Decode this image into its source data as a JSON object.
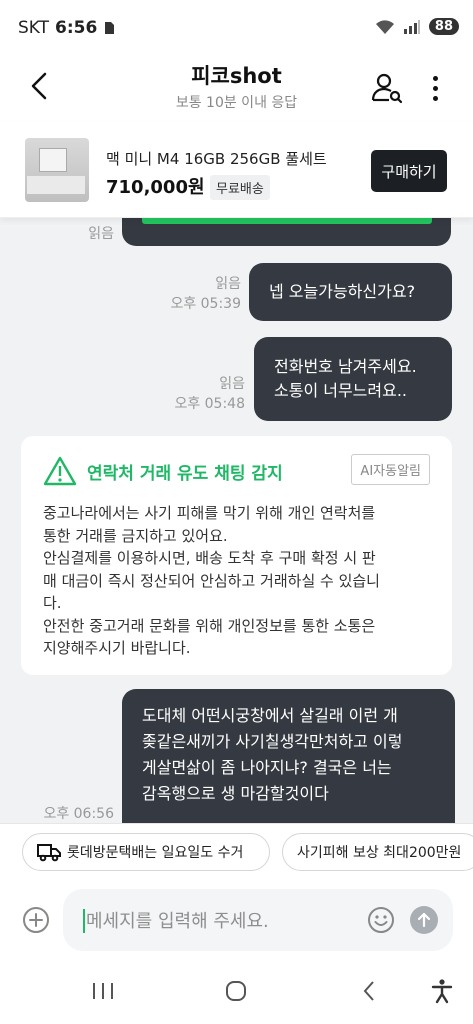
{
  "status_bar": {
    "carrier": "SKT",
    "time": "6:56",
    "battery": "88"
  },
  "header": {
    "title": "피코shot",
    "subtitle": "보통 10분 이내 응답"
  },
  "product": {
    "name": "맥 미니 M4 16GB 256GB 풀세트",
    "price": "710,000원",
    "shipping": "무료배송",
    "buy_label": "구매하기"
  },
  "messages": [
    {
      "read": "읽음",
      "time": "",
      "text": ""
    },
    {
      "read": "읽음",
      "time": "오후 05:39",
      "text": "넵  오늘가능하신가요?"
    },
    {
      "read": "읽음",
      "time": "오후 05:48",
      "lines": [
        "전화번호  남겨주세요.",
        "소통이 너무느려요.."
      ]
    }
  ],
  "notice": {
    "title": "연락처 거래 유도 채팅 감지",
    "badge": "AI자동알림",
    "lines": [
      "중고나라에서는 사기 피해를 막기 위해 개인 연락처를",
      "통한 거래를 금지하고 있어요.",
      "안심결제를 이용하시면, 배송 도착 후 구매 확정 시 판",
      "매 대금이 즉시 정산되어 안심하고 거래하실 수 있습니",
      "다.",
      "안전한 중고거래 문화를 위해 개인정보를 통한 소통은",
      "지양해주시기 바랍니다."
    ]
  },
  "last_message": {
    "time": "오후 06:56",
    "lines": [
      "도대체 어떤시궁창에서 살길래   이런 개",
      "좆같은새끼가 사기칠생각만처하고  이렇",
      "게살면삶이 좀 나아지냐?  결국은 너는",
      "감옥행으로 생 마감할것이다"
    ]
  },
  "chips": [
    "롯데방문택배는 일요일도 수거",
    "사기피해 보상 최대200만원"
  ],
  "input": {
    "placeholder": "메세지를 입력해 주세요."
  },
  "colors": {
    "accent_green": "#20b866",
    "bubble_dark": "#353a42",
    "chat_bg": "#f1f2f4"
  }
}
